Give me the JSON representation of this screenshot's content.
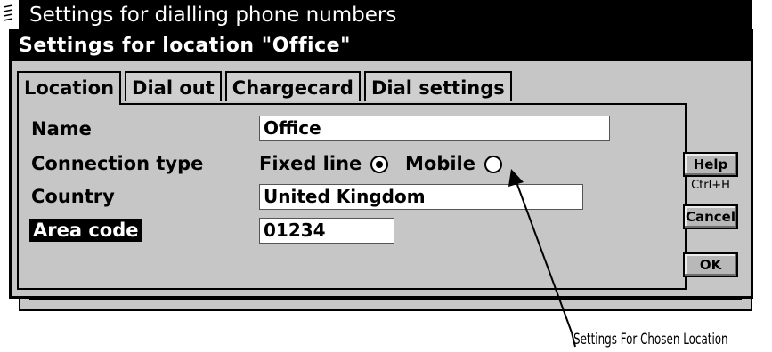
{
  "background_dialog": {
    "title": "Settings for dialling phone numbers"
  },
  "dialog": {
    "title": "Settings for location \"Office\""
  },
  "tabs": [
    {
      "label": "Location",
      "active": true
    },
    {
      "label": "Dial out",
      "active": false
    },
    {
      "label": "Chargecard",
      "active": false
    },
    {
      "label": "Dial settings",
      "active": false
    }
  ],
  "fields": {
    "name": {
      "label": "Name",
      "value": "Office"
    },
    "connection_type": {
      "label": "Connection type",
      "options": [
        {
          "label": "Fixed line",
          "selected": true
        },
        {
          "label": "Mobile",
          "selected": false
        }
      ]
    },
    "country": {
      "label": "Country",
      "value": "United Kingdom"
    },
    "area_code": {
      "label": "Area code",
      "value": "01234"
    }
  },
  "buttons": {
    "help": {
      "label": "Help",
      "shortcut": "Ctrl+H"
    },
    "cancel": {
      "label": "Cancel"
    },
    "ok": {
      "label": "OK"
    }
  },
  "callout": {
    "text": "Settings For Chosen Location"
  },
  "colors": {
    "titlebar": "#000000",
    "dialog_bg": "#c6c6c6",
    "input_bg": "#ffffff"
  }
}
